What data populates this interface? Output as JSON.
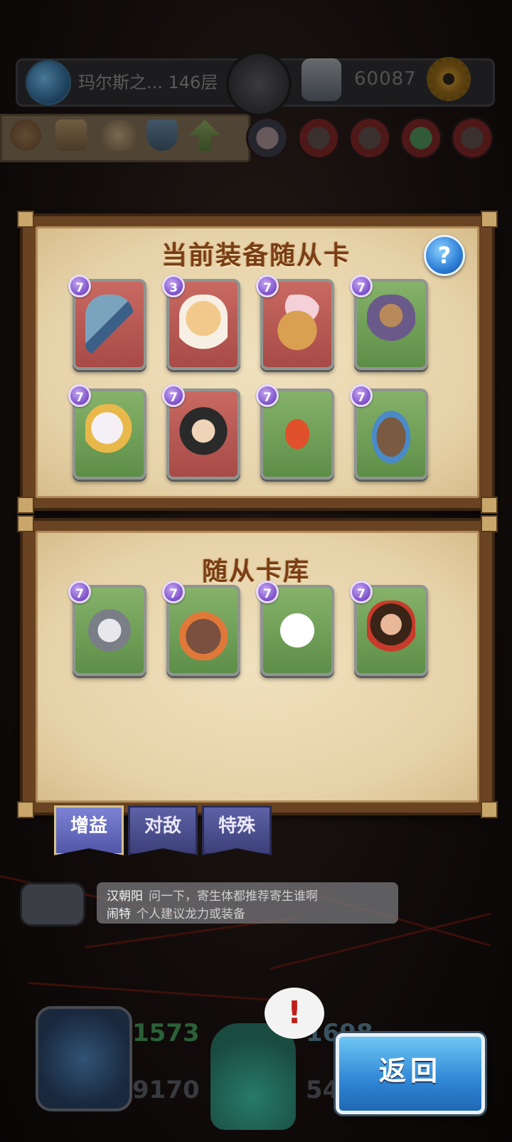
{
  "header": {
    "floor_label": "玛尔斯之... 146层",
    "gold_value": "60087"
  },
  "equipped_panel": {
    "title": "当前装备随从卡",
    "help_label": "?",
    "cards": [
      {
        "level": "7",
        "color": "red",
        "subject": "hammer"
      },
      {
        "level": "3",
        "color": "red",
        "subject": "hamster"
      },
      {
        "level": "7",
        "color": "red",
        "subject": "leopard"
      },
      {
        "level": "7",
        "color": "green",
        "subject": "warrior"
      },
      {
        "level": "7",
        "color": "green",
        "subject": "winged-girl"
      },
      {
        "level": "7",
        "color": "red",
        "subject": "fluffy-cat"
      },
      {
        "level": "7",
        "color": "green",
        "subject": "red-hood-girl"
      },
      {
        "level": "7",
        "color": "green",
        "subject": "mammoth"
      }
    ]
  },
  "library_panel": {
    "title": "随从卡库",
    "cards": [
      {
        "level": "7",
        "color": "green",
        "subject": "husky"
      },
      {
        "level": "7",
        "color": "green",
        "subject": "fire-bear"
      },
      {
        "level": "7",
        "color": "green",
        "subject": "white-puppy"
      },
      {
        "level": "7",
        "color": "green",
        "subject": "curly-hair-woman"
      }
    ]
  },
  "tabs": [
    "增益",
    "对敌",
    "特殊"
  ],
  "chat": {
    "messages": [
      {
        "user": "汉朝阳",
        "text": "问一下，寄生体都推荐寄生谁啊"
      },
      {
        "user": "闹特",
        "text": "个人建议龙力或装备"
      }
    ]
  },
  "bottom": {
    "stat_top_left": "1573",
    "stat_top_right": "1698",
    "stat_bottom_left": "9170",
    "stat_bottom_right": "54",
    "alert_symbol": "!",
    "back_label": "返回"
  },
  "colors": {
    "card_red": "#b85650",
    "card_green": "#6f9c56",
    "level_badge": "#8a5bd6",
    "title_text": "#7a3e14",
    "back_button": "#3a92da"
  }
}
